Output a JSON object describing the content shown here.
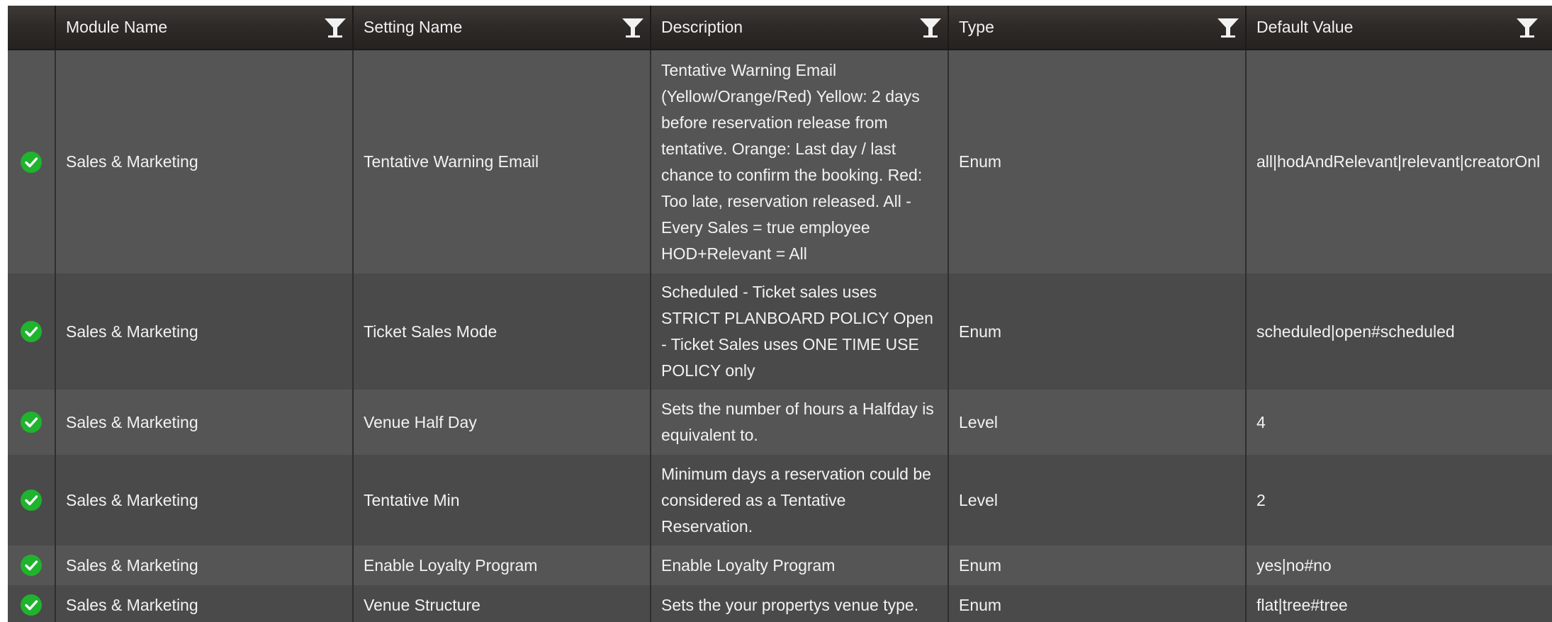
{
  "columns": {
    "status": "",
    "module_name": "Module Name",
    "setting_name": "Setting Name",
    "description": "Description",
    "type": "Type",
    "default_value": "Default Value"
  },
  "icons": {
    "filter": "filter-funnel-icon",
    "status": "check-circle-icon"
  },
  "colors": {
    "header_bg": "#2f2b29",
    "row_odd": "#555555",
    "row_even": "#4a4a4a",
    "status_green": "#1fb32e"
  },
  "rows": [
    {
      "module_name": "Sales & Marketing",
      "setting_name": "Tentative Warning Email",
      "description": "Tentative Warning Email (Yellow/Orange/Red) Yellow: 2 days before reservation release from tentative. Orange: Last day / last chance to confirm the booking. Red: Too late, reservation released. All - Every Sales = true employee HOD+Relevant = All",
      "type": "Enum",
      "default_value": "all|hodAndRelevant|relevant|creatorOnl"
    },
    {
      "module_name": "Sales & Marketing",
      "setting_name": "Ticket Sales Mode",
      "description": "Scheduled - Ticket sales uses STRICT PLANBOARD POLICY Open - Ticket Sales uses ONE TIME USE POLICY only",
      "type": "Enum",
      "default_value": "scheduled|open#scheduled"
    },
    {
      "module_name": "Sales & Marketing",
      "setting_name": "Venue Half Day",
      "description": "Sets the number of hours a Halfday is equivalent to.",
      "type": "Level",
      "default_value": "4"
    },
    {
      "module_name": "Sales & Marketing",
      "setting_name": "Tentative Min",
      "description": "Minimum days a reservation could be considered as a Tentative Reservation.",
      "type": "Level",
      "default_value": "2"
    },
    {
      "module_name": "Sales & Marketing",
      "setting_name": "Enable Loyalty Program",
      "description": "Enable Loyalty Program",
      "type": "Enum",
      "default_value": "yes|no#no"
    },
    {
      "module_name": "Sales & Marketing",
      "setting_name": "Venue Structure",
      "description": "Sets the your propertys venue type.",
      "type": "Enum",
      "default_value": "flat|tree#tree"
    }
  ]
}
